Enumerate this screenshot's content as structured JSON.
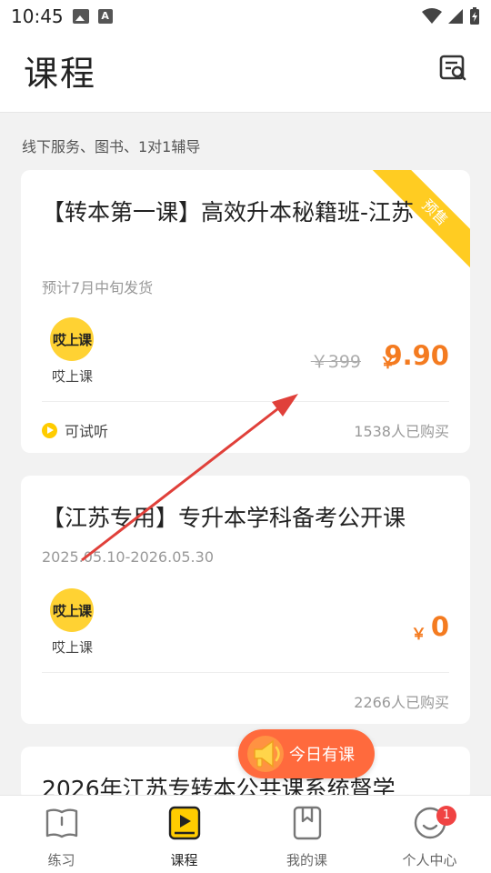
{
  "status_bar": {
    "time": "10:45",
    "a_icon_text": "A"
  },
  "header": {
    "title": "课程"
  },
  "section_label": "线下服务、图书、1对1辅导",
  "courses": [
    {
      "title": "【转本第一课】高效升本秘籍班-江苏",
      "subtitle": "预计7月中旬发货",
      "ribbon": "预售",
      "org_logo_text": "哎上课",
      "org_name": "哎上课",
      "price_old": "￥399",
      "price_symbol": "￥",
      "price": "9.90",
      "trial_label": "可试听",
      "buyers": "1538人已购买"
    },
    {
      "title": "【江苏专用】专升本学科备考公开课",
      "subtitle": "2025.05.10-2026.05.30",
      "org_logo_text": "哎上课",
      "org_name": "哎上课",
      "price_symbol": "￥",
      "price": "0",
      "buyers": "2266人已购买"
    },
    {
      "title": "2026年江苏专转本公共课系统督学"
    }
  ],
  "floating_button": {
    "label": "今日有课"
  },
  "tabbar": {
    "items": [
      {
        "label": "练习",
        "icon": "book-icon"
      },
      {
        "label": "课程",
        "icon": "course-play-icon"
      },
      {
        "label": "我的课",
        "icon": "bookmark-book-icon"
      },
      {
        "label": "个人中心",
        "icon": "profile-smile-icon",
        "badge": "1"
      }
    ],
    "active_index": 1,
    "accent": "#ffcc00"
  },
  "colors": {
    "price": "#f47b20",
    "accent": "#ffcc00",
    "floating": "#ff6a3d",
    "annotation_arrow": "#e0403a"
  }
}
